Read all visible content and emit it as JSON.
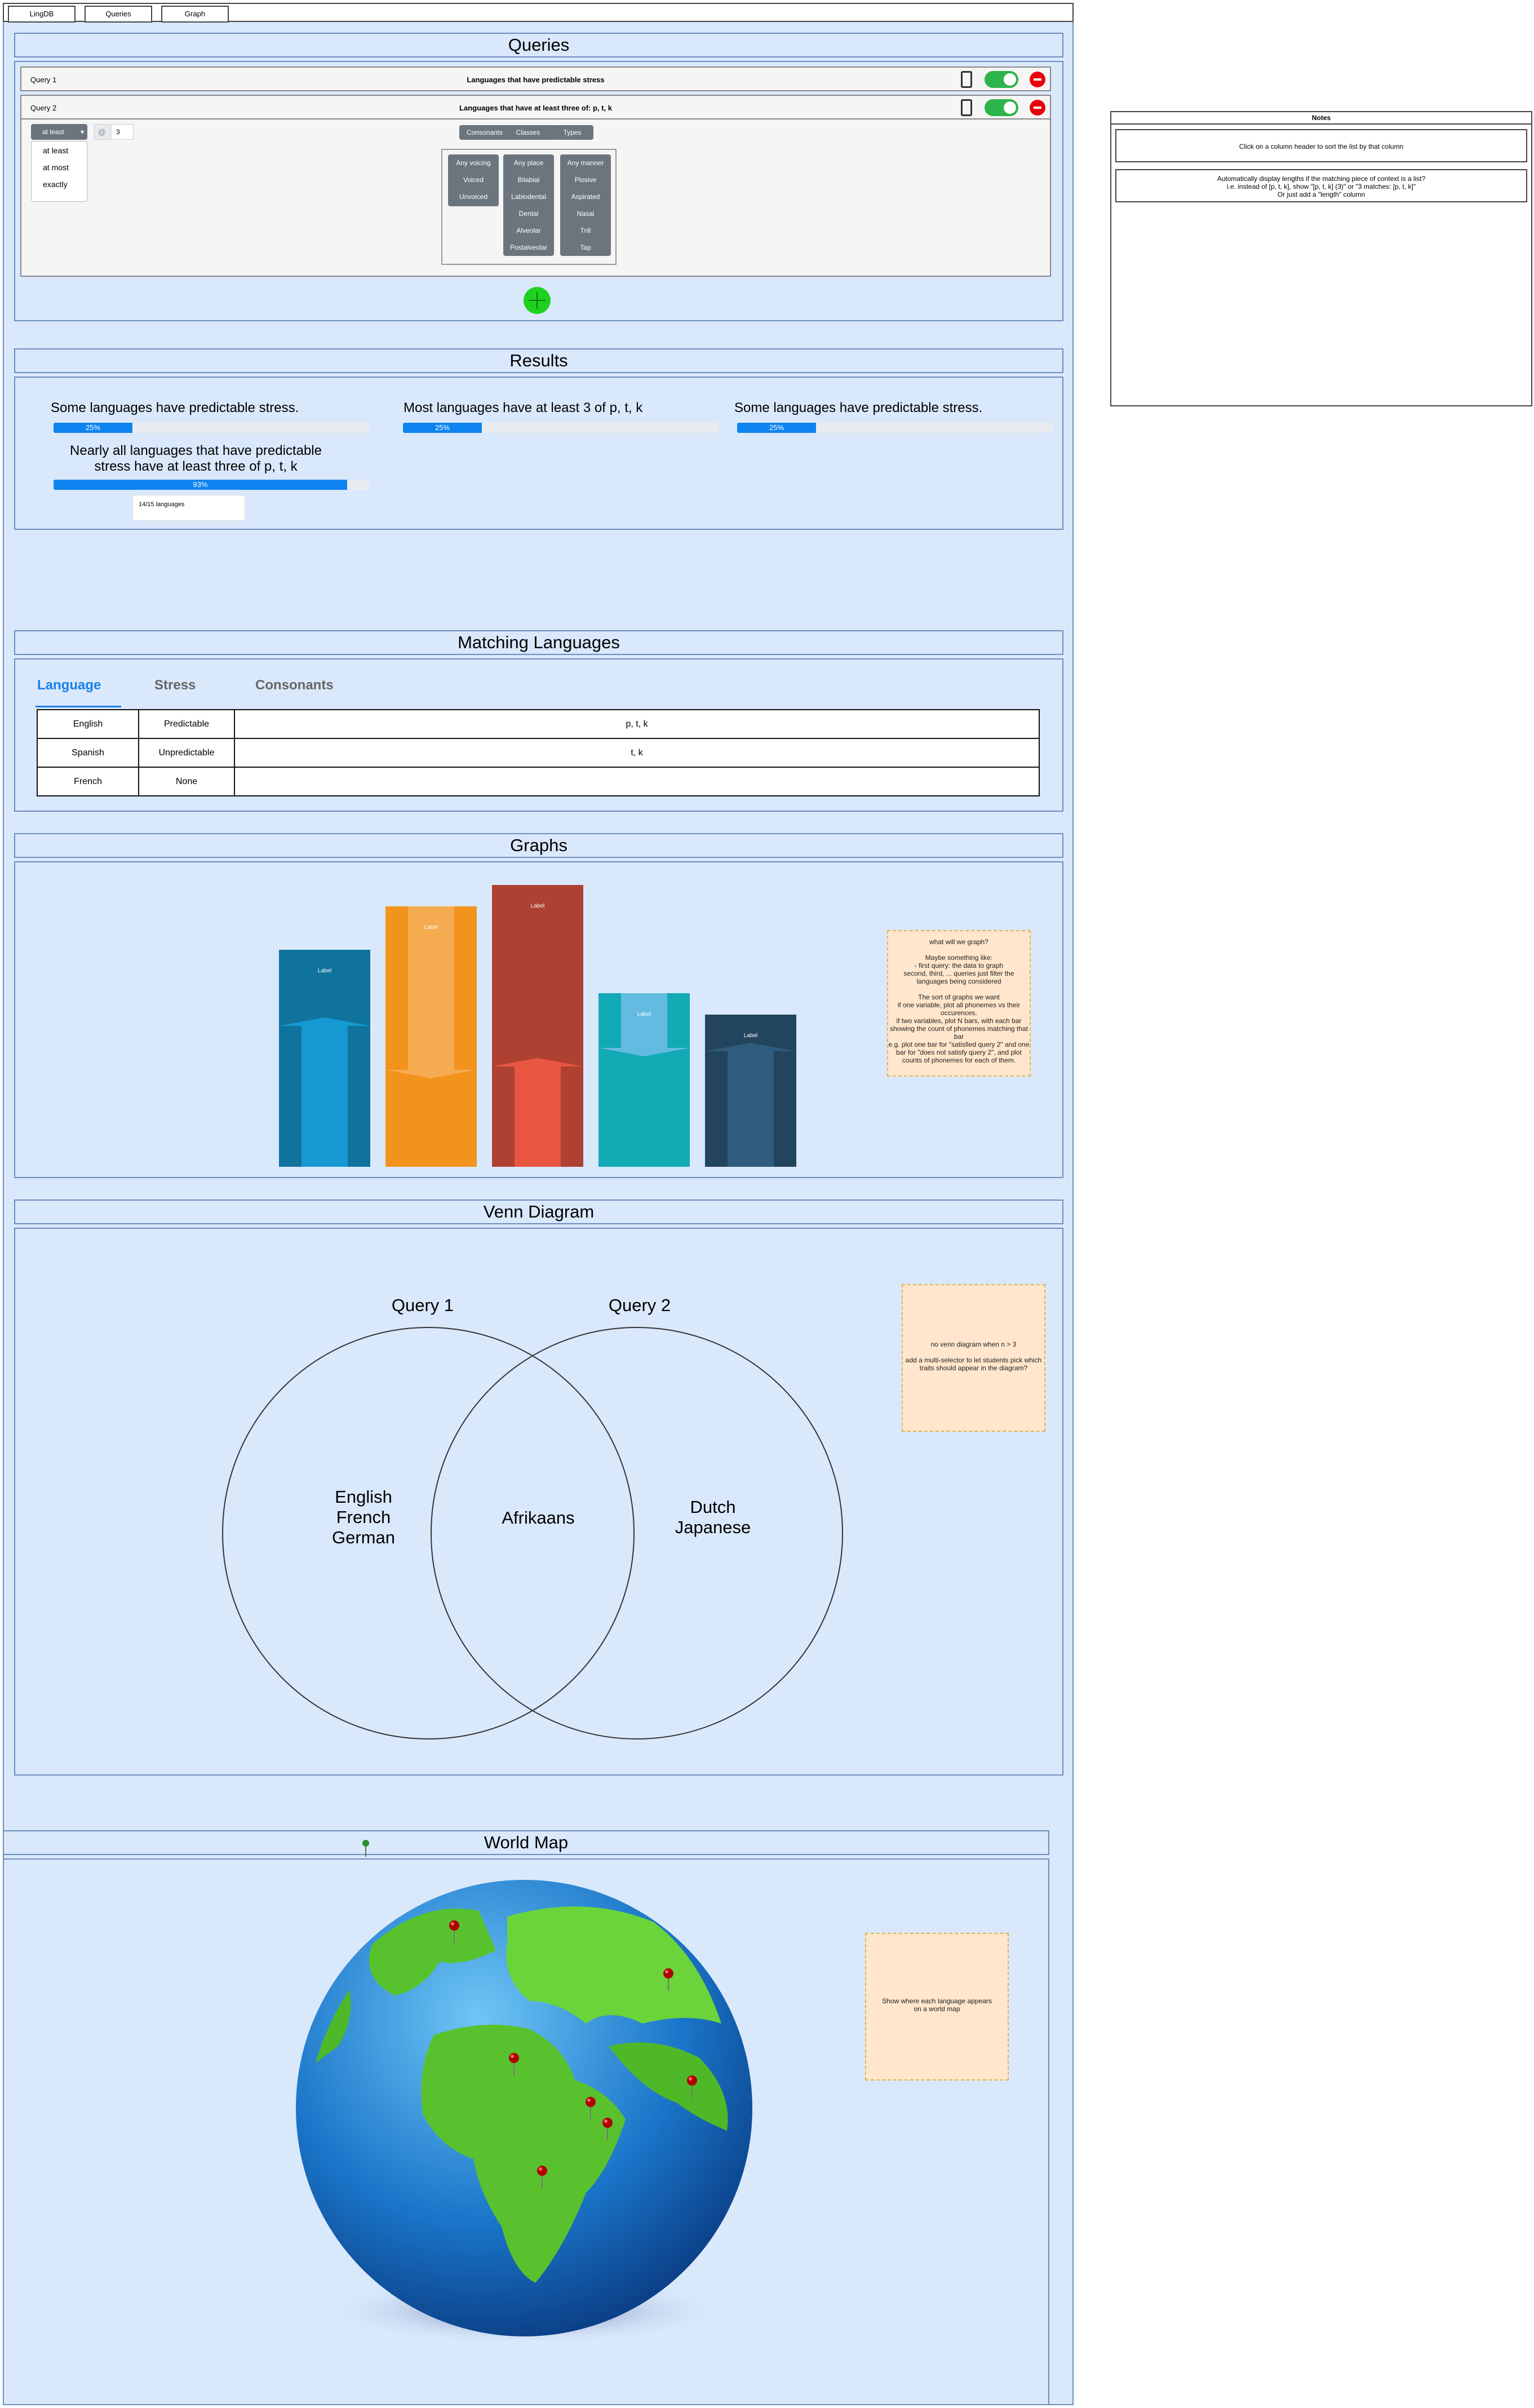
{
  "tabs": [
    "LingDB",
    "Queries",
    "Graph"
  ],
  "queries": {
    "title": "Queries",
    "rows": [
      {
        "label": "Query 1",
        "title": "Languages that have predictable stress"
      },
      {
        "label": "Query 2",
        "title": "Languages that have at least three of: p, t, k"
      }
    ],
    "quantifier": {
      "selected": "at least",
      "options": [
        "at least",
        "at most",
        "exactly"
      ],
      "at_symbol": "@",
      "count": "3"
    },
    "tabs": [
      "Consonants",
      "Classes",
      "Types"
    ],
    "voicing": [
      "Any voicing",
      "Voiced",
      "Unvoiced"
    ],
    "place": [
      "Any place",
      "Bilabial",
      "Labiodental",
      "Dental",
      "Alveolar",
      "Postalveolar"
    ],
    "manner": [
      "Any manner",
      "Plosive",
      "Aspirated",
      "Nasal",
      "Trill",
      "Tap"
    ]
  },
  "results": {
    "title": "Results",
    "items": [
      {
        "text": "Some languages have predictable stress.",
        "percent": 25,
        "label": "25%"
      },
      {
        "text": "Most languages have at least 3 of p, t, k",
        "percent": 25,
        "label": "25%"
      },
      {
        "text": "Some languages have predictable stress.",
        "percent": 25,
        "label": "25%"
      },
      {
        "text": "Nearly all languages that have predictable stress have at least three of p, t, k",
        "percent": 93,
        "label": "93%"
      }
    ],
    "tooltip": "14/15 languages"
  },
  "matching": {
    "title": "Matching Languages",
    "headers": [
      "Language",
      "Stress",
      "Consonants"
    ],
    "rows": [
      [
        "English",
        "Predictable",
        "p, t, k"
      ],
      [
        "Spanish",
        "Unpredictable",
        "t, k"
      ],
      [
        "French",
        "None",
        ""
      ]
    ]
  },
  "graphs": {
    "title": "Graphs",
    "bar_label": "Label",
    "colors": [
      "#10739e",
      "#f2931e",
      "#ae4132",
      "#12aab5",
      "#23445d"
    ],
    "note": [
      "what will we graph?",
      "",
      "Maybe something like:",
      "- first query: the data to graph",
      "second, third, ... queries just filter the",
      "languages being considered",
      "",
      "The sort of graphs we want",
      "if one variable, plot all phonemes vs their",
      "occurences.",
      "if two variables, plot N bars, with each bar",
      "showing the count of phonemes matching that",
      "bar",
      "e.g. plot one bar for \"satisfied query 2\" and one",
      "bar for \"does not satisfy query 2\", and plot",
      "counts of phonemes for each of them."
    ]
  },
  "venn": {
    "title": "Venn Diagram",
    "left_title": "Query 1",
    "right_title": "Query 2",
    "left_only": [
      "English",
      "French",
      "German"
    ],
    "both": [
      "Afrikaans"
    ],
    "right_only": [
      "Dutch",
      "Japanese"
    ],
    "note": [
      "no venn diagram when n > 3",
      "",
      "add a multi-selector to let students pick which",
      "traits should appear in the diagram?"
    ]
  },
  "worldmap": {
    "title": "World Map",
    "note": [
      "Show where each language appears",
      "on a world map"
    ]
  },
  "notes": {
    "title": "Notes",
    "items": [
      [
        "Click on a column header to sort the list by that column"
      ],
      [
        "Automatically display lengths if the matching piece of context is a list?",
        "i.e. instead of [p, t, k], show \"[p, t, k] (3)\" or \"3 matches: [p, t, k]\"",
        "Or just add a \"length\" column"
      ]
    ]
  }
}
